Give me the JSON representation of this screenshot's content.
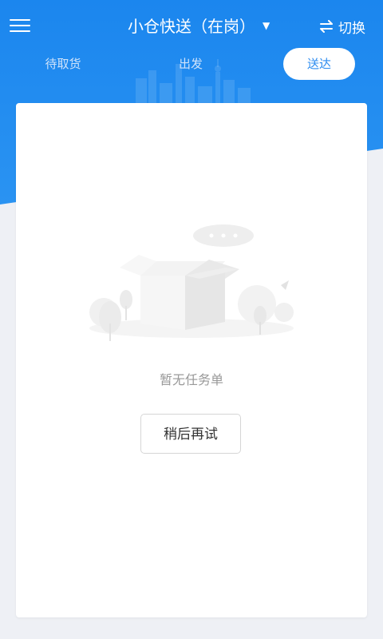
{
  "header": {
    "title": "小仓快送（在岗）",
    "switch_label": "切换",
    "icons": [
      "menu-icon",
      "caret-down-icon",
      "swap-icon"
    ]
  },
  "tabs": [
    {
      "label": "待取货",
      "active": false
    },
    {
      "label": "出发",
      "active": false
    },
    {
      "label": "送达",
      "active": true
    }
  ],
  "empty_state": {
    "message": "暂无任务单",
    "retry_label": "稍后再试"
  },
  "colors": {
    "brand_blue": "#1f8aee",
    "background": "#eef0f5",
    "card": "#ffffff"
  }
}
